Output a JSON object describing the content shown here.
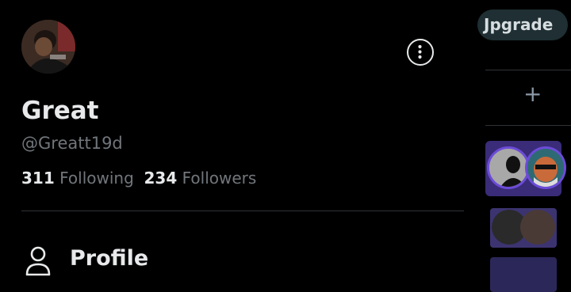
{
  "profile": {
    "name": "Great",
    "handle": "@Greatt19d",
    "following_count": "311",
    "following_label": "Following",
    "followers_count": "234",
    "followers_label": "Followers"
  },
  "nav": {
    "items": [
      {
        "label": "Profile",
        "icon": "person-icon"
      }
    ]
  },
  "right_panel": {
    "upgrade_label": "Jpgrade",
    "add_glyph": "+"
  },
  "colors": {
    "background": "#000000",
    "text_primary": "#e7e9ea",
    "text_secondary": "#71767b",
    "divider": "#2f3336",
    "space_card": "#3a2c78"
  }
}
